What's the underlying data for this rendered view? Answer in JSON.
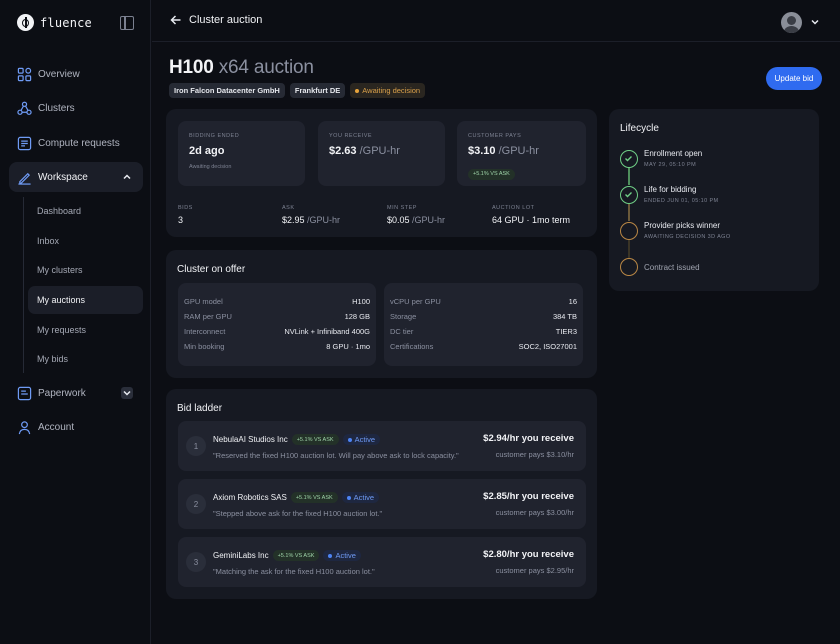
{
  "app": {
    "name": "fluence"
  },
  "sidebar": {
    "items": [
      {
        "label": "Overview"
      },
      {
        "label": "Clusters"
      },
      {
        "label": "Compute requests"
      },
      {
        "label": "Workspace"
      },
      {
        "label": "Paperwork"
      },
      {
        "label": "Account"
      }
    ],
    "workspace_sub": [
      {
        "label": "Dashboard"
      },
      {
        "label": "Inbox"
      },
      {
        "label": "My clusters"
      },
      {
        "label": "My auctions"
      },
      {
        "label": "My requests"
      },
      {
        "label": "My bids"
      }
    ]
  },
  "topbar": {
    "title": "Cluster auction"
  },
  "header": {
    "title_main": "H100",
    "title_sub": "x64 auction",
    "tags": [
      "Iron Falcon Datacenter GmbH",
      "Frankfurt DE"
    ],
    "status": "Awaiting decision",
    "update_button": "Update bid"
  },
  "summary": {
    "bidding_ended": {
      "label": "BIDDING ENDED",
      "value": "2d ago",
      "note": "Awaiting decision"
    },
    "you_receive": {
      "label": "YOU RECEIVE",
      "value": "$2.63",
      "unit": "/GPU-hr"
    },
    "customer_pays": {
      "label": "CUSTOMER PAYS",
      "value": "$3.10",
      "unit": "/GPU-hr",
      "badge": "+5.1% VS ASK"
    },
    "stats": [
      {
        "label": "BIDS",
        "value": "3",
        "unit": ""
      },
      {
        "label": "ASK",
        "value": "$2.95",
        "unit": "/GPU-hr"
      },
      {
        "label": "MIN STEP",
        "value": "$0.05",
        "unit": "/GPU-hr"
      },
      {
        "label": "AUCTION LOT",
        "value": "64 GPU · 1mo term",
        "unit": ""
      }
    ]
  },
  "cluster": {
    "title": "Cluster on offer",
    "left": [
      {
        "k": "GPU model",
        "v": "H100"
      },
      {
        "k": "RAM per GPU",
        "v": "128 GB"
      },
      {
        "k": "Interconnect",
        "v": "NVLink + Infiniband 400G"
      },
      {
        "k": "Min booking",
        "v": "8 GPU · 1mo"
      }
    ],
    "right": [
      {
        "k": "vCPU per GPU",
        "v": "16"
      },
      {
        "k": "Storage",
        "v": "384 TB"
      },
      {
        "k": "DC tier",
        "v": "TIER3"
      },
      {
        "k": "Certifications",
        "v": "SOC2, ISO27001"
      }
    ]
  },
  "ladder": {
    "title": "Bid ladder",
    "bids": [
      {
        "rank": "1",
        "name": "NebulaAI Studios Inc",
        "badge": "+5.1% VS ASK",
        "status": "Active",
        "quote": "\"Reserved the fixed H100 auction lot. Will pay above ask to lock capacity.\"",
        "receive": "$2.94/hr you receive",
        "pays": "customer pays $3.10/hr"
      },
      {
        "rank": "2",
        "name": "Axiom Robotics SAS",
        "badge": "+5.1% VS ASK",
        "status": "Active",
        "quote": "\"Stepped above ask for the fixed H100 auction lot.\"",
        "receive": "$2.85/hr you receive",
        "pays": "customer pays $3.00/hr"
      },
      {
        "rank": "3",
        "name": "GeminiLabs Inc",
        "badge": "+5.1% VS ASK",
        "status": "Active",
        "quote": "\"Matching the ask for the fixed H100 auction lot.\"",
        "receive": "$2.80/hr you receive",
        "pays": "customer pays $2.95/hr"
      }
    ]
  },
  "lifecycle": {
    "title": "Lifecycle",
    "steps": [
      {
        "title": "Enrollment open",
        "sub": "MAY 29, 05:10 PM",
        "state": "done"
      },
      {
        "title": "Life for bidding",
        "sub": "ENDED JUN 01, 05:10 PM",
        "state": "done"
      },
      {
        "title": "Provider picks winner",
        "sub": "AWAITING DECISION 3D AGO",
        "state": "pending"
      },
      {
        "title": "Contract issued",
        "sub": "",
        "state": "pending"
      }
    ]
  }
}
